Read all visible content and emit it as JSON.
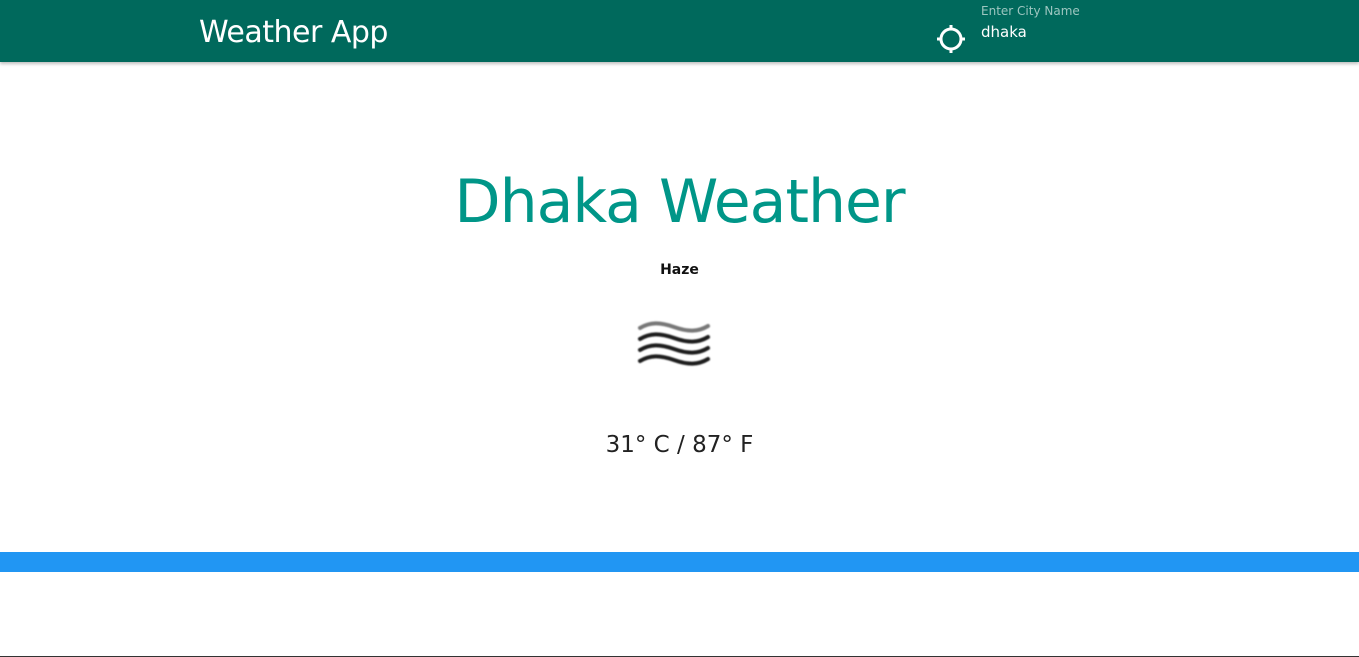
{
  "header": {
    "brand": "Weather App",
    "locate_icon": "crosshair-icon",
    "city_label": "Enter City Name",
    "city_value": "dhaka"
  },
  "main": {
    "title": "Dhaka Weather",
    "condition": "Haze",
    "condition_icon": "haze-icon",
    "temperature": "31° C / 87° F"
  },
  "colors": {
    "navbar": "#00695c",
    "title": "#009688",
    "footer_bar": "#2196f3"
  }
}
